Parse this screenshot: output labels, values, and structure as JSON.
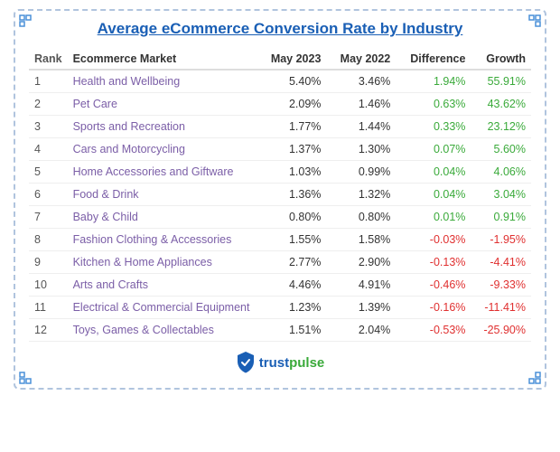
{
  "title": "Average eCommerce Conversion Rate by Industry",
  "columns": [
    "Rank",
    "Ecommerce Market",
    "May 2023",
    "May 2022",
    "Difference",
    "Growth"
  ],
  "rows": [
    {
      "rank": "1",
      "market": "Health and Wellbeing",
      "may2023": "5.40%",
      "may2022": "3.46%",
      "diff": "1.94%",
      "growth": "55.91%",
      "diffType": "pos",
      "growthType": "pos"
    },
    {
      "rank": "2",
      "market": "Pet Care",
      "may2023": "2.09%",
      "may2022": "1.46%",
      "diff": "0.63%",
      "growth": "43.62%",
      "diffType": "pos",
      "growthType": "pos"
    },
    {
      "rank": "3",
      "market": "Sports and Recreation",
      "may2023": "1.77%",
      "may2022": "1.44%",
      "diff": "0.33%",
      "growth": "23.12%",
      "diffType": "pos",
      "growthType": "pos"
    },
    {
      "rank": "4",
      "market": "Cars and Motorcycling",
      "may2023": "1.37%",
      "may2022": "1.30%",
      "diff": "0.07%",
      "growth": "5.60%",
      "diffType": "pos",
      "growthType": "pos"
    },
    {
      "rank": "5",
      "market": "Home Accessories and Giftware",
      "may2023": "1.03%",
      "may2022": "0.99%",
      "diff": "0.04%",
      "growth": "4.06%",
      "diffType": "pos",
      "growthType": "pos"
    },
    {
      "rank": "6",
      "market": "Food & Drink",
      "may2023": "1.36%",
      "may2022": "1.32%",
      "diff": "0.04%",
      "growth": "3.04%",
      "diffType": "pos",
      "growthType": "pos"
    },
    {
      "rank": "7",
      "market": "Baby & Child",
      "may2023": "0.80%",
      "may2022": "0.80%",
      "diff": "0.01%",
      "growth": "0.91%",
      "diffType": "pos",
      "growthType": "pos"
    },
    {
      "rank": "8",
      "market": "Fashion Clothing & Accessories",
      "may2023": "1.55%",
      "may2022": "1.58%",
      "diff": "-0.03%",
      "growth": "-1.95%",
      "diffType": "neg",
      "growthType": "neg"
    },
    {
      "rank": "9",
      "market": "Kitchen & Home Appliances",
      "may2023": "2.77%",
      "may2022": "2.90%",
      "diff": "-0.13%",
      "growth": "-4.41%",
      "diffType": "neg",
      "growthType": "neg"
    },
    {
      "rank": "10",
      "market": "Arts and Crafts",
      "may2023": "4.46%",
      "may2022": "4.91%",
      "diff": "-0.46%",
      "growth": "-9.33%",
      "diffType": "neg",
      "growthType": "neg"
    },
    {
      "rank": "11",
      "market": "Electrical & Commercial Equipment",
      "may2023": "1.23%",
      "may2022": "1.39%",
      "diff": "-0.16%",
      "growth": "-11.41%",
      "diffType": "neg",
      "growthType": "neg"
    },
    {
      "rank": "12",
      "market": "Toys, Games & Collectables",
      "may2023": "1.51%",
      "may2022": "2.04%",
      "diff": "-0.53%",
      "growth": "-25.90%",
      "diffType": "neg",
      "growthType": "neg"
    }
  ],
  "footer": {
    "brand": "trustpulse"
  }
}
